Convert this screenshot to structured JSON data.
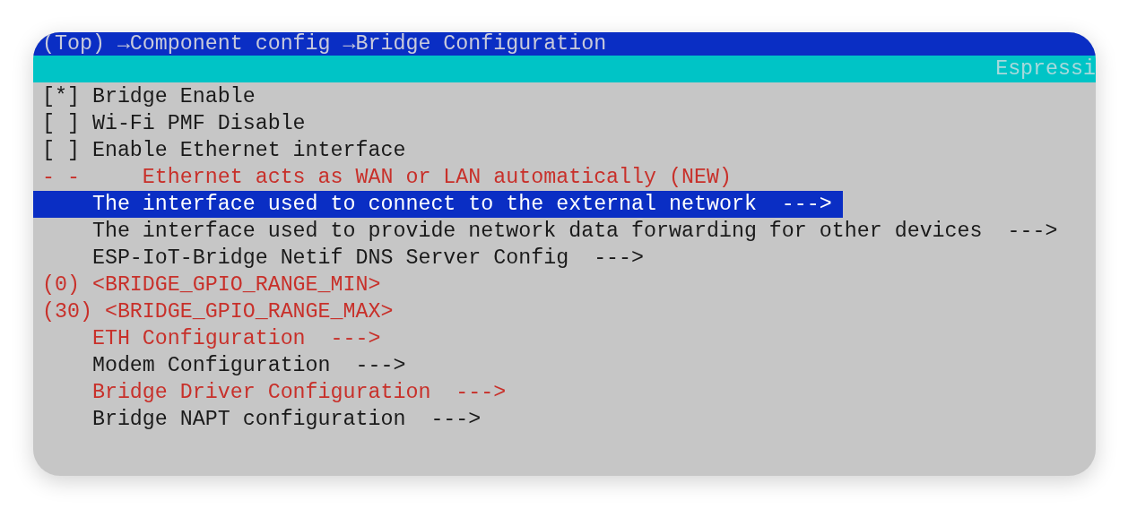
{
  "title_bar": {
    "breadcrumb": "(Top) →Component config →Bridge Configuration"
  },
  "subtitle_bar": {
    "text": "Espressi"
  },
  "menu": [
    {
      "text": "[*] Bridge Enable",
      "selected": false,
      "inactive": false
    },
    {
      "text": "[ ] Wi-Fi PMF Disable",
      "selected": false,
      "inactive": false
    },
    {
      "text": "[ ] Enable Ethernet interface",
      "selected": false,
      "inactive": false
    },
    {
      "text": "- -     Ethernet acts as WAN or LAN automatically (NEW)",
      "selected": false,
      "inactive": true
    },
    {
      "text": "    The interface used to connect to the external network  --->",
      "selected": true,
      "inactive": false
    },
    {
      "text": "    The interface used to provide network data forwarding for other devices  --->",
      "selected": false,
      "inactive": false
    },
    {
      "text": "    ESP-IoT-Bridge Netif DNS Server Config  --->",
      "selected": false,
      "inactive": false
    },
    {
      "text": "(0) <BRIDGE_GPIO_RANGE_MIN>",
      "selected": false,
      "inactive": true
    },
    {
      "text": "(30) <BRIDGE_GPIO_RANGE_MAX>",
      "selected": false,
      "inactive": true
    },
    {
      "text": "    ETH Configuration  --->",
      "selected": false,
      "inactive": true
    },
    {
      "text": "    Modem Configuration  --->",
      "selected": false,
      "inactive": false
    },
    {
      "text": "    Bridge Driver Configuration  --->",
      "selected": false,
      "inactive": true
    },
    {
      "text": "    Bridge NAPT configuration  --->",
      "selected": false,
      "inactive": false
    }
  ]
}
